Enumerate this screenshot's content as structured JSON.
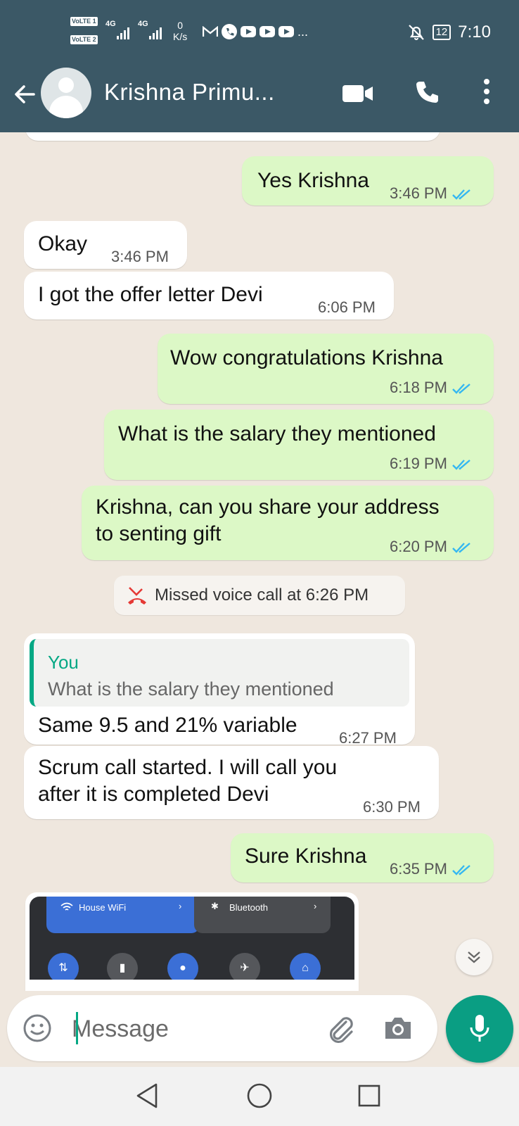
{
  "status_bar": {
    "sim1_label": "VoLTE 1",
    "sim2_label": "VoLTE 2",
    "network1": "4G",
    "network2": "4G",
    "speed_value": "0",
    "speed_unit": "K/s",
    "more_indicator": "...",
    "battery": "12",
    "time": "7:10"
  },
  "header": {
    "contact_name": "Krishna  Primu..."
  },
  "messages": [
    {
      "dir": "out",
      "text": "Yes Krishna",
      "time": "3:46 PM"
    },
    {
      "dir": "in",
      "text": "Okay",
      "time": "3:46 PM"
    },
    {
      "dir": "in",
      "text": "I got the offer letter Devi",
      "time": "6:06 PM"
    },
    {
      "dir": "out",
      "text": "Wow congratulations Krishna",
      "time": "6:18 PM"
    },
    {
      "dir": "out",
      "text": "What is the salary they mentioned",
      "time": "6:19 PM"
    },
    {
      "dir": "out",
      "text_line1": "Krishna, can you share your address",
      "text_line2": "to senting gift",
      "time": "6:20 PM"
    },
    {
      "dir": "system",
      "text": "Missed voice call at 6:26 PM"
    },
    {
      "dir": "in",
      "quote_author": "You",
      "quote_text": "What is the salary they mentioned",
      "text": "Same 9.5 and 21% variable",
      "time": "6:27 PM"
    },
    {
      "dir": "in",
      "text_line1": "Scrum  call started. I will call you",
      "text_line2": "after it is completed Devi",
      "time": "6:30 PM"
    },
    {
      "dir": "out",
      "text": "Sure Krishna",
      "time": "6:35 PM"
    }
  ],
  "preview_image": {
    "wifi_label": "House WiFi",
    "bluetooth_label": "Bluetooth"
  },
  "composer": {
    "placeholder": "Message"
  },
  "colors": {
    "header_bg": "#3b5866",
    "chat_bg": "#efe7de",
    "outgoing_bubble": "#dcf8c6",
    "incoming_bubble": "#ffffff",
    "read_ticks": "#34b7f1",
    "accent_green": "#0a9e83"
  }
}
